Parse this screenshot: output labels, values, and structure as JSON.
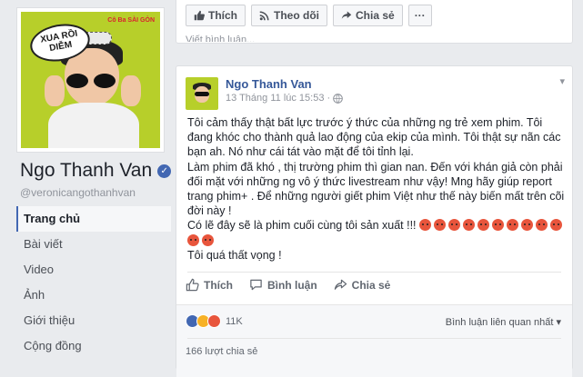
{
  "page": {
    "cover_bubble": "XUA RỒI DIỄM",
    "cover_tag": "Cô Ba SÀI GÒN",
    "name": "Ngo Thanh Van",
    "handle": "@veronicangothanhvan"
  },
  "nav": {
    "items": [
      "Trang chủ",
      "Bài viết",
      "Video",
      "Ảnh",
      "Giới thiệu",
      "Cộng đồng"
    ]
  },
  "top_actions": {
    "like": "Thích",
    "follow": "Theo dõi",
    "share": "Chia sẻ",
    "more": "···",
    "cut_text": "Viết bình luận..."
  },
  "post": {
    "author": "Ngo Thanh Van",
    "time": "13 Tháng 11 lúc 15:53 ·",
    "paragraphs": [
      "Tôi cảm thấy thật bất lực trước ý thức của những ng trẻ xem phim. Tôi đang khóc cho thành quả lao động của ekip của mình. Tôi thật sự nãn các bạn ah. Nó như cái tát vào mặt để tôi tỉnh lại.",
      "Làm phim đã khó , thị trường phim thì gian nan. Đến với khán giả còn phải đối mặt với những ng vô ý thức livestream như vậy! Mng hãy giúp report trang phim+ . Để những người giết phim Việt như thế này biến mất trên cõi đời này !",
      "Có lẽ đây sẽ là phim cuối cùng tôi sản xuất !!!",
      "Tôi quá thất vọng !"
    ],
    "actions": {
      "like": "Thích",
      "comment": "Bình luận",
      "share": "Chia sẻ"
    },
    "reactions_count": "11K",
    "sort_label": "Bình luận liên quan nhất ▾",
    "shares": "166 lượt chia sẻ"
  },
  "colors": {
    "link": "#365899",
    "like_blue": "#4267b2",
    "angry": "#e8553c",
    "cover_green": "#b7cf2a"
  }
}
